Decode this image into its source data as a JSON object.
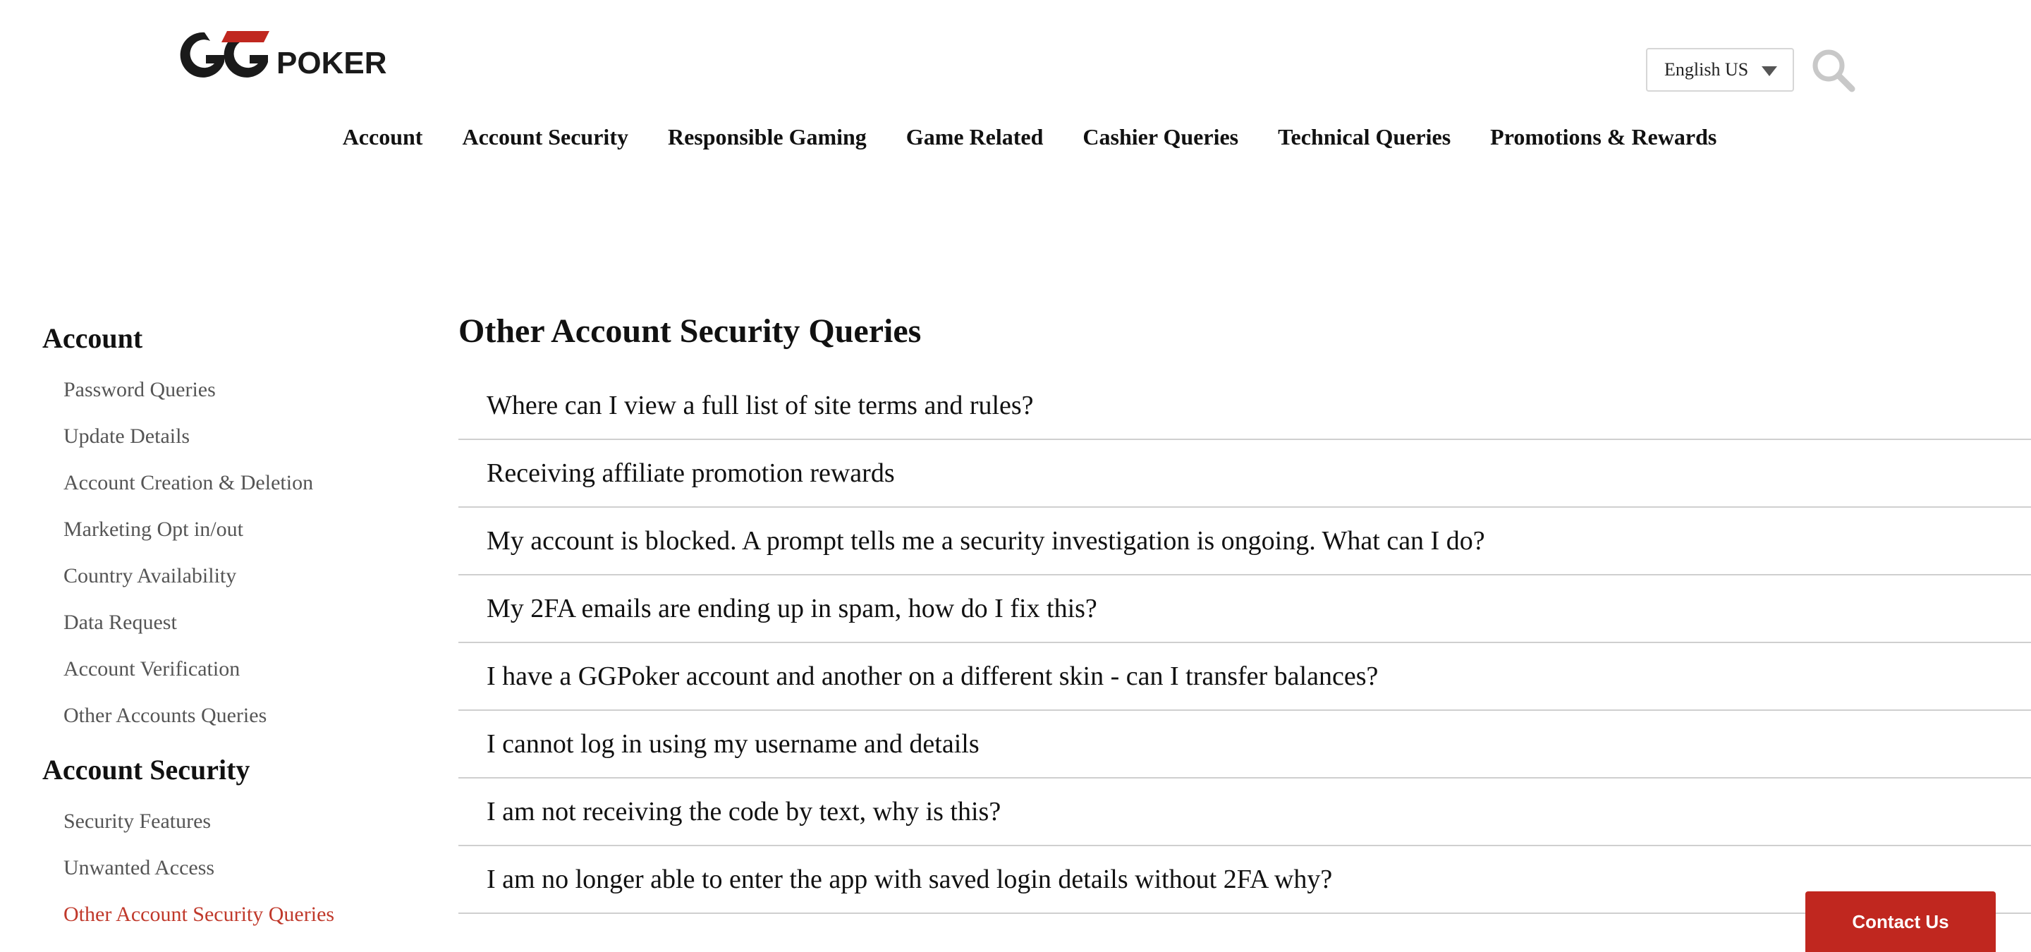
{
  "brand": {
    "logo_prefix": "GG",
    "logo_suffix": "POKER",
    "accent_color": "#c0271f",
    "logo_icon": "ggpoker-logo"
  },
  "header": {
    "language": "English US",
    "search_icon": "search-icon"
  },
  "topnav": [
    {
      "label": "Account"
    },
    {
      "label": "Account Security"
    },
    {
      "label": "Responsible Gaming"
    },
    {
      "label": "Game Related"
    },
    {
      "label": "Cashier Queries"
    },
    {
      "label": "Technical Queries"
    },
    {
      "label": "Promotions & Rewards"
    }
  ],
  "sidebar": {
    "groups": [
      {
        "heading": "Account",
        "items": [
          {
            "label": "Password Queries"
          },
          {
            "label": "Update Details"
          },
          {
            "label": "Account Creation & Deletion"
          },
          {
            "label": "Marketing Opt in/out"
          },
          {
            "label": "Country Availability"
          },
          {
            "label": "Data Request"
          },
          {
            "label": "Account Verification"
          },
          {
            "label": "Other Accounts Queries"
          }
        ]
      },
      {
        "heading": "Account Security",
        "items": [
          {
            "label": "Security Features"
          },
          {
            "label": "Unwanted Access"
          },
          {
            "label": "Other Account Security Queries",
            "active": true
          }
        ]
      }
    ]
  },
  "main": {
    "title": "Other Account Security Queries",
    "questions": [
      "Where can I view a full list of site terms and rules?",
      "Receiving affiliate promotion rewards",
      "My account is blocked. A prompt tells me a security investigation is ongoing. What can I do?",
      "My 2FA emails are ending up in spam, how do I fix this?",
      "I have a GGPoker account and another on a different skin - can I transfer balances?",
      "I cannot log in using my username and details",
      "I am not receiving the code by text, why is this?",
      "I am no longer able to enter the app with saved login details without 2FA why?"
    ]
  },
  "contact": {
    "label": "Contact Us"
  }
}
